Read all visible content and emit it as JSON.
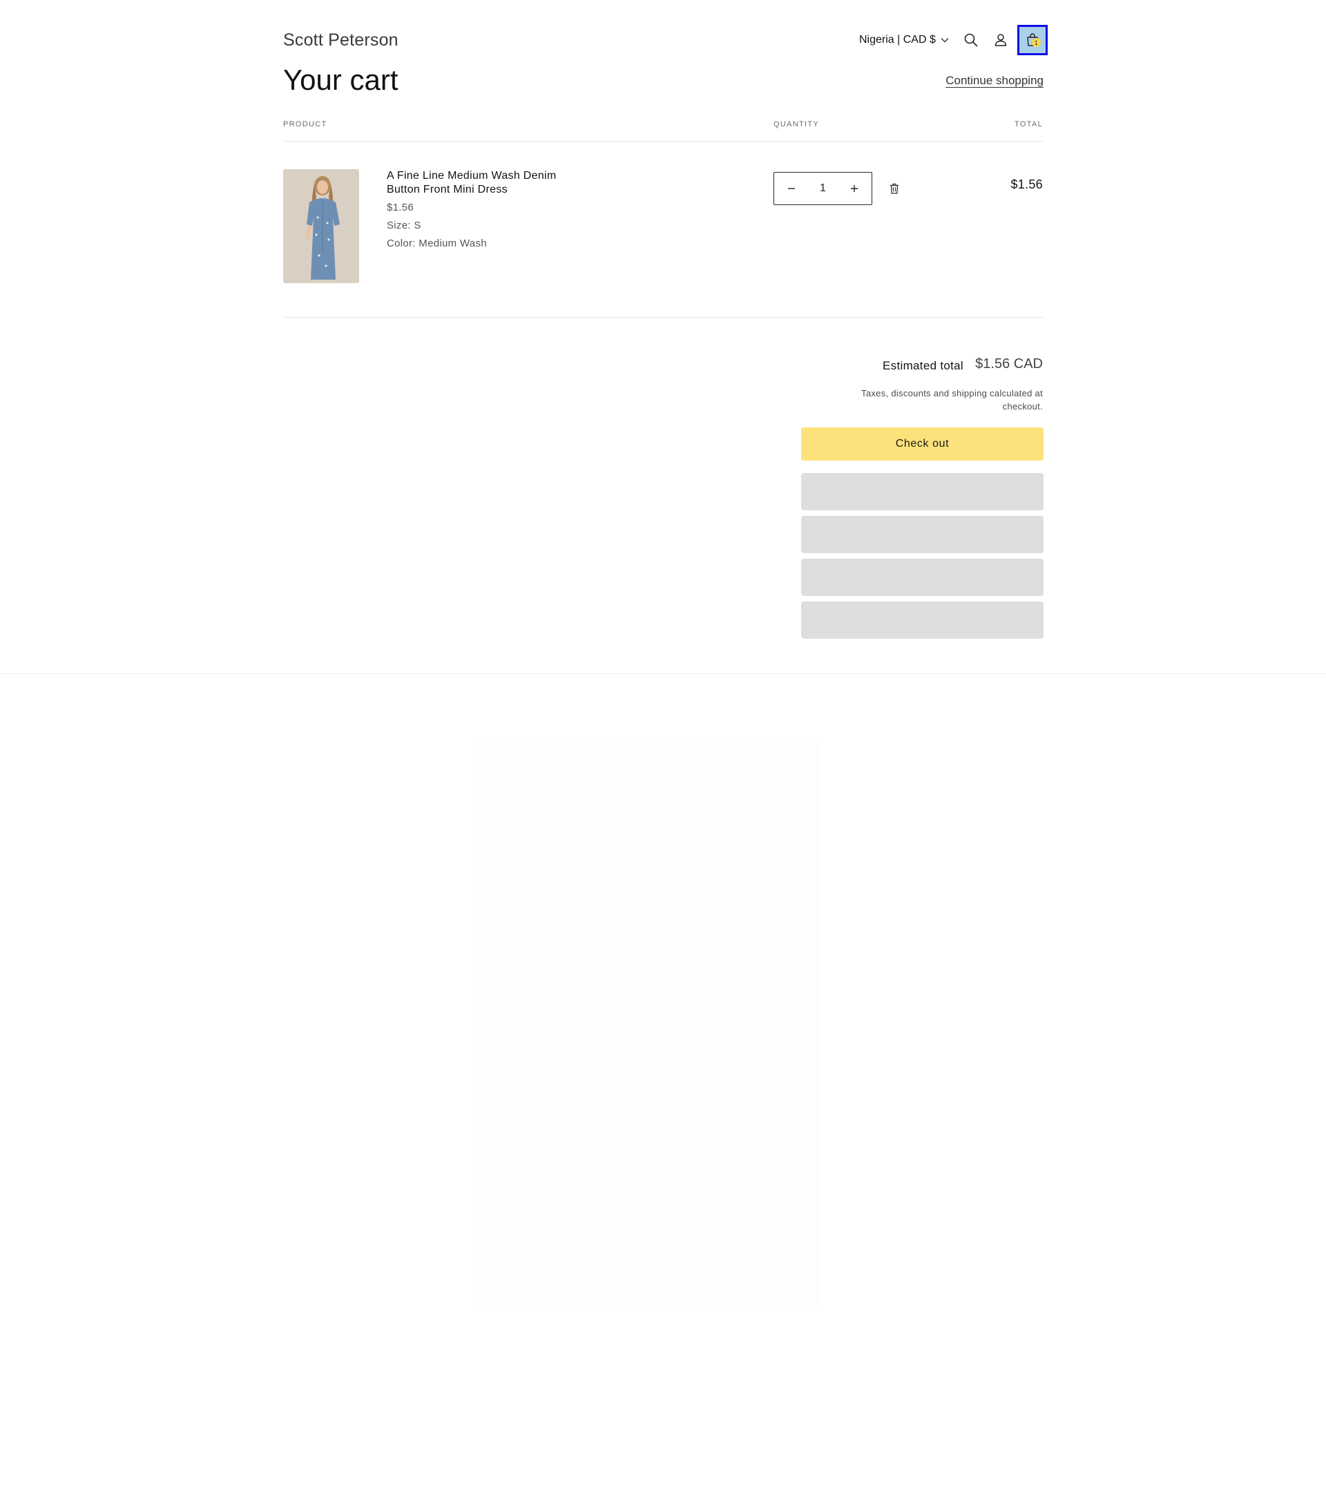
{
  "header": {
    "logo": "Scott Peterson",
    "country_selector": "Nigeria | CAD $",
    "cart_count": "1",
    "icons": [
      "search-icon",
      "account-icon",
      "cart-icon",
      "chevron-down-icon"
    ]
  },
  "page": {
    "title": "Your cart",
    "continue_shopping": "Continue shopping"
  },
  "table_headers": {
    "product": "PRODUCT",
    "quantity": "QUANTITY",
    "total": "TOTAL"
  },
  "items": [
    {
      "name": "A Fine Line Medium Wash Denim Button Front Mini Dress",
      "price": "$1.56",
      "size": "Size: S",
      "color": "Color: Medium Wash",
      "quantity": "1",
      "line_total": "$1.56"
    }
  ],
  "summary": {
    "estimated_label": "Estimated total",
    "estimated_value": "$1.56 CAD",
    "tax_note": "Taxes, discounts and shipping calculated at checkout.",
    "checkout_label": "Check out"
  },
  "colors": {
    "checkout_bg": "#fce27b",
    "cart_highlight": "#a9cfe9",
    "cart_focus_border": "#0a0ae6",
    "payment_placeholder": "#dedede"
  }
}
